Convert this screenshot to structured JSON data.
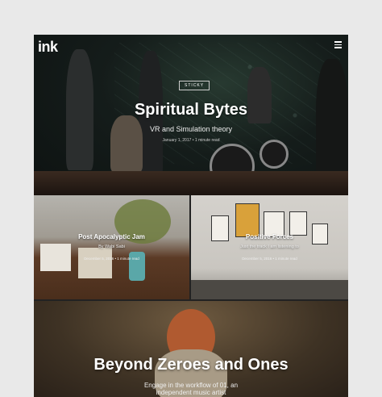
{
  "site": {
    "logo": "ink"
  },
  "hero": {
    "badge": "STICKY",
    "title": "Spiritual Bytes",
    "subtitle": "VR and Simulation theory",
    "meta": "January 1, 2017  •  1 minute read"
  },
  "cards": [
    {
      "title": "Post Apocalyptic Jam",
      "subtitle": "By Wabi Sabi",
      "meta": "December 5, 2016  •  1 minute read"
    },
    {
      "title": "Positive Forces",
      "subtitle": "Just the track I am listening to",
      "meta": "December 5, 2016  •  1 minute read"
    }
  ],
  "feature": {
    "title": "Beyond Zeroes and Ones",
    "subtitle_line1": "Engage in the workflow of 01, an",
    "subtitle_line2": "independent music artist"
  }
}
